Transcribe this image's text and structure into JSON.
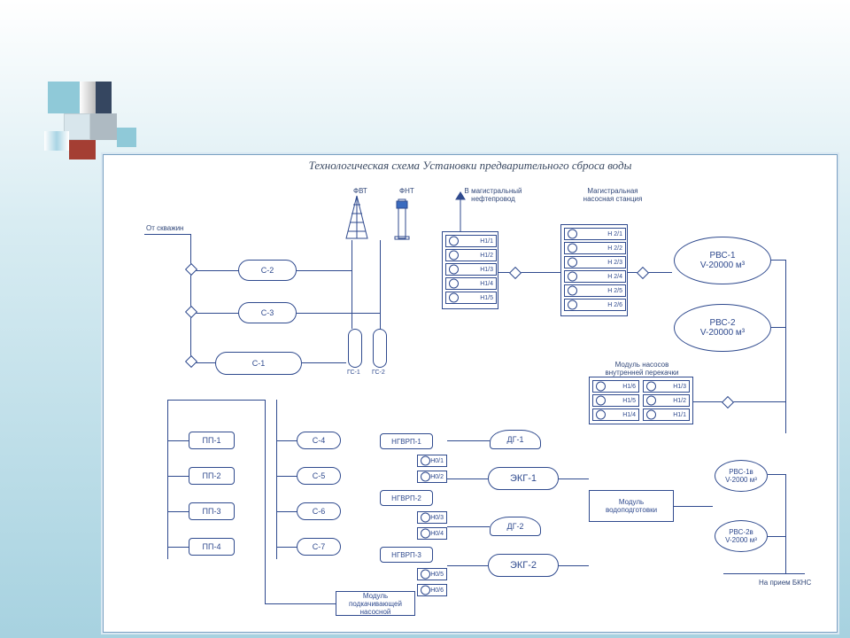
{
  "title": "Технологическая схема Установки предварительного сброса воды",
  "labels": {
    "from_wells": "От скважин",
    "fvt": "ФВТ",
    "fnt": "ФНТ",
    "to_pipe": "В магистральный нефтепровод",
    "main_pump_station": "Магистральная насосная станция",
    "internal_pump_module": "Модуль насосов внутренней перекачки",
    "booster_module": "Модуль подкачивающей насосной",
    "water_module": "Модуль водоподготовки",
    "to_bkns": "На прием БКНС"
  },
  "separators": {
    "c1": "С-1",
    "c2": "С-2",
    "c3": "С-3",
    "c4": "С-4",
    "c5": "С-5",
    "c6": "С-6",
    "c7": "С-7"
  },
  "gas_cyl": {
    "gs1": "ГС-1",
    "gs2": "ГС-2"
  },
  "pp": [
    "ПП-1",
    "ПП-2",
    "ПП-3",
    "ПП-4"
  ],
  "ngvrp": [
    "НГВРП-1",
    "НГВРП-2",
    "НГВРП-3"
  ],
  "n01": [
    "Н0/1",
    "Н0/2",
    "Н0/3",
    "Н0/4",
    "Н0/5",
    "Н0/6"
  ],
  "main_pumps_left": [
    "Н1/1",
    "Н1/2",
    "Н1/3",
    "Н1/4",
    "Н1/5"
  ],
  "right_pumps": [
    "Н 2/1",
    "Н 2/2",
    "Н 2/3",
    "Н 2/4",
    "Н 2/5",
    "Н 2/6"
  ],
  "internal_pumps": [
    "Н1/6",
    "Н1/5",
    "Н1/4",
    "Н1/3",
    "Н1/2",
    "Н1/1"
  ],
  "dg": [
    "ДГ-1",
    "ДГ-2"
  ],
  "ekg": [
    "ЭКГ-1",
    "ЭКГ-2"
  ],
  "tanks": {
    "rvs1": {
      "name": "РВС-1",
      "vol": "V-20000 м³"
    },
    "rvs2": {
      "name": "РВС-2",
      "vol": "V-20000 м³"
    },
    "rvs1b": {
      "name": "РВС-1в",
      "vol": "V-2000 м³"
    },
    "rvs2b": {
      "name": "РВС-2в",
      "vol": "V-2000 м³"
    }
  }
}
